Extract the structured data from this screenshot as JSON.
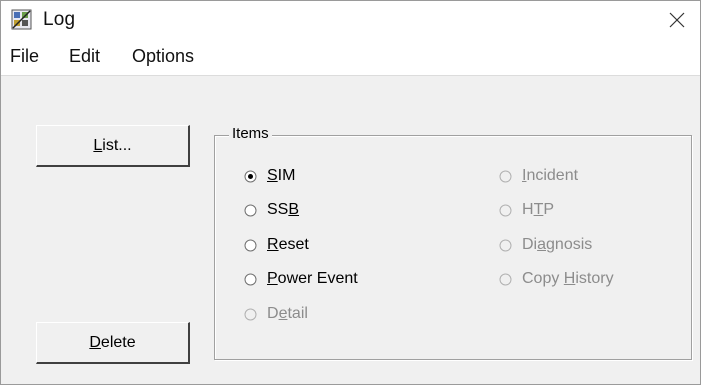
{
  "window": {
    "title": "Log"
  },
  "menu": {
    "file": "File",
    "edit": "Edit",
    "options": "Options"
  },
  "buttons": {
    "list": {
      "pre": "",
      "u": "L",
      "post": "ist..."
    },
    "delete": {
      "pre": "",
      "u": "D",
      "post": "elete"
    }
  },
  "items_group": {
    "label": "Items",
    "options": [
      {
        "pre": "",
        "u": "S",
        "post": "IM",
        "checked": true,
        "enabled": true
      },
      {
        "pre": "SS",
        "u": "B",
        "post": "",
        "checked": false,
        "enabled": true
      },
      {
        "pre": "",
        "u": "R",
        "post": "eset",
        "checked": false,
        "enabled": true
      },
      {
        "pre": "",
        "u": "P",
        "post": "ower Event",
        "checked": false,
        "enabled": true
      },
      {
        "pre": "D",
        "u": "e",
        "post": "tail",
        "checked": false,
        "enabled": false
      },
      {
        "pre": "",
        "u": "I",
        "post": "ncident",
        "checked": false,
        "enabled": false
      },
      {
        "pre": "H",
        "u": "T",
        "post": "P",
        "checked": false,
        "enabled": false
      },
      {
        "pre": "Di",
        "u": "a",
        "post": "gnosis",
        "checked": false,
        "enabled": false
      },
      {
        "pre": "Copy ",
        "u": "H",
        "post": "istory",
        "checked": false,
        "enabled": false
      }
    ]
  },
  "colors": {
    "face": "#f0f0f0",
    "disabled_text": "#8c8c8c",
    "frame": "#a0a0a0"
  },
  "icons": {
    "app": "log-app-icon",
    "close": "close-icon",
    "radio": "radio-button-icon"
  }
}
